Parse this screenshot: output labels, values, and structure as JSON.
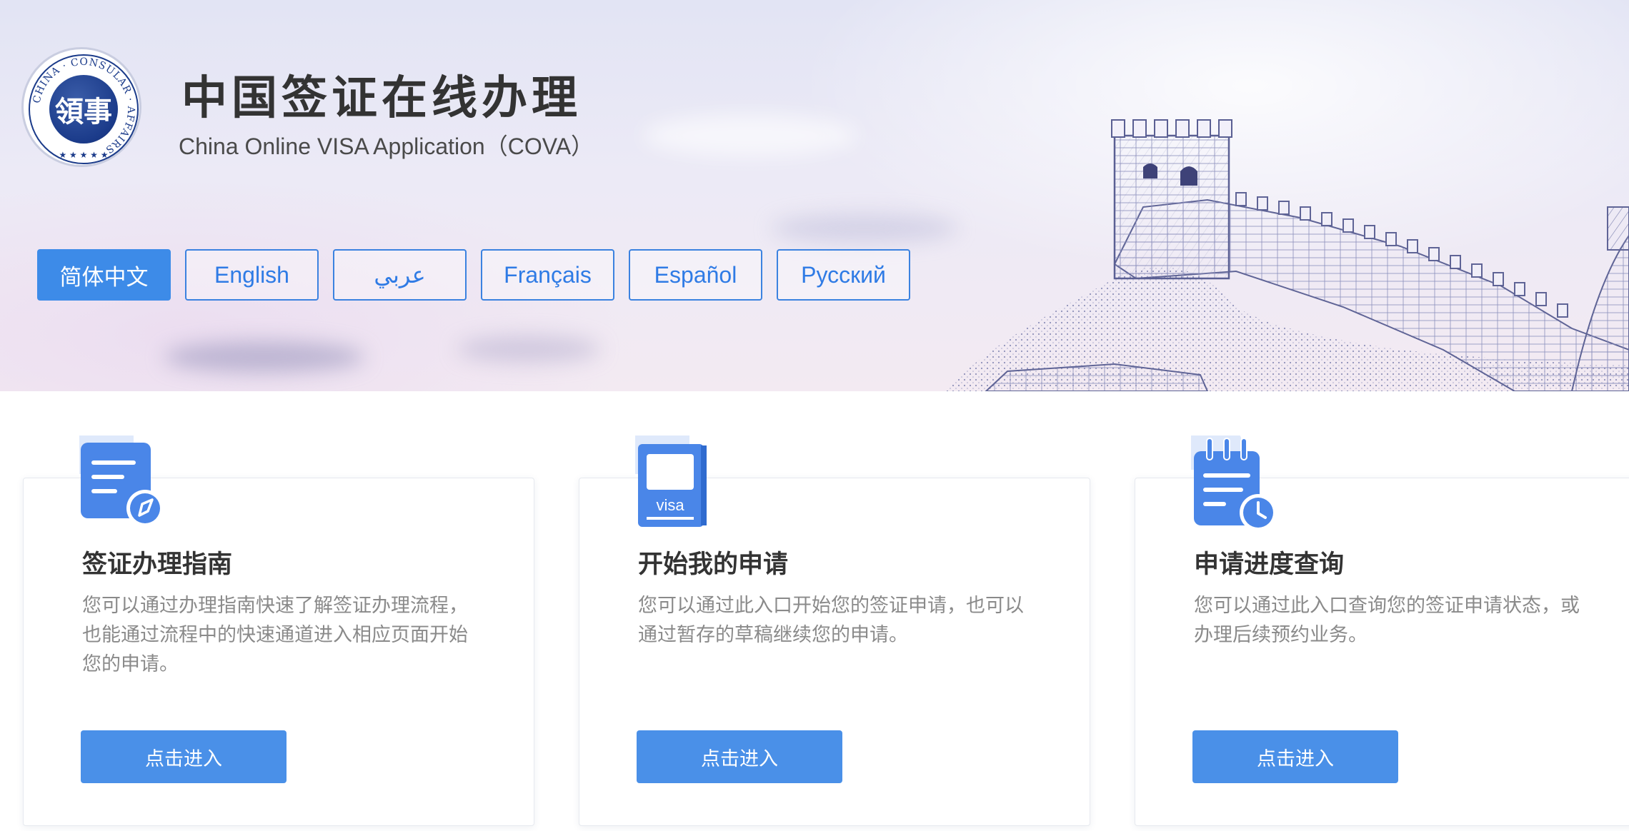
{
  "header": {
    "title": "中国签证在线办理",
    "subtitle": "China Online VISA Application（COVA）",
    "logo_ring_text": "CHINA · CONSULAR · AFFAIRS",
    "logo_center_text": "領事",
    "logo_stars": "★ ★ ★ ★ ★"
  },
  "languages": [
    {
      "label": "简体中文",
      "active": true
    },
    {
      "label": "English",
      "active": false
    },
    {
      "label": "عربي",
      "active": false
    },
    {
      "label": "Français",
      "active": false
    },
    {
      "label": "Español",
      "active": false
    },
    {
      "label": "Русский",
      "active": false
    }
  ],
  "cards": [
    {
      "icon": "guide-document-icon",
      "title": "签证办理指南",
      "description": "您可以通过办理指南快速了解签证办理流程，也能通过流程中的快速通道进入相应页面开始您的申请。",
      "button": "点击进入"
    },
    {
      "icon": "visa-passport-icon",
      "title": "开始我的申请",
      "description": "您可以通过此入口开始您的签证申请，也可以通过暂存的草稿继续您的申请。",
      "button": "点击进入",
      "icon_text": "visa"
    },
    {
      "icon": "progress-notepad-clock-icon",
      "title": "申请进度查询",
      "description": "您可以通过此入口查询您的签证申请状态，或办理后续预约业务。",
      "button": "点击进入"
    }
  ],
  "colors": {
    "accent": "#3d8be8",
    "button": "#4a90e8",
    "icon_blue": "#4a86e8",
    "title_text": "#333333",
    "muted_text": "#8a8a8a"
  }
}
